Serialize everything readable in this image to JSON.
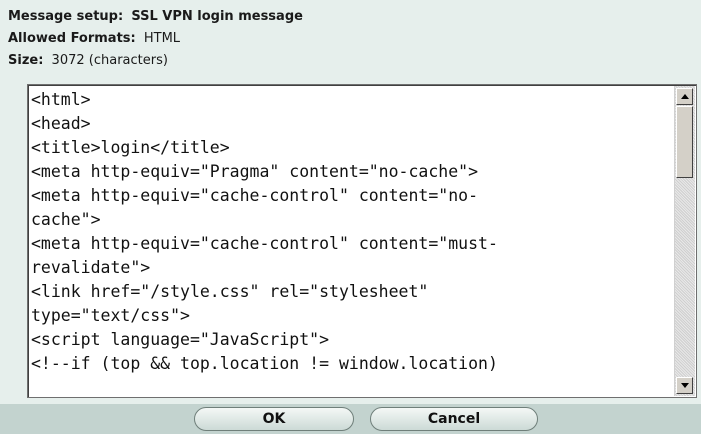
{
  "header": {
    "message_setup_label": "Message setup:",
    "message_setup_value": "SSL VPN login message",
    "allowed_formats_label": "Allowed Formats:",
    "allowed_formats_value": "HTML",
    "size_label": "Size:",
    "size_value": "3072 (characters)"
  },
  "editor": {
    "lines": [
      "<html>",
      "<head>",
      "<title>login</title>",
      "<meta http-equiv=\"Pragma\" content=\"no-cache\">",
      "<meta http-equiv=\"cache-control\" content=\"no-",
      "cache\">",
      "<meta http-equiv=\"cache-control\" content=\"must-",
      "revalidate\">",
      "<link href=\"/style.css\" rel=\"stylesheet\"",
      "type=\"text/css\">",
      "<script language=\"JavaScript\">",
      "<!--if (top && top.location != window.location)"
    ]
  },
  "buttons": {
    "ok_label": "OK",
    "cancel_label": "Cancel"
  },
  "colors": {
    "background": "#e6efec",
    "footer": "#c3d3cf"
  },
  "icons": {
    "scroll_up": "arrow-up-icon",
    "scroll_down": "arrow-down-icon"
  }
}
